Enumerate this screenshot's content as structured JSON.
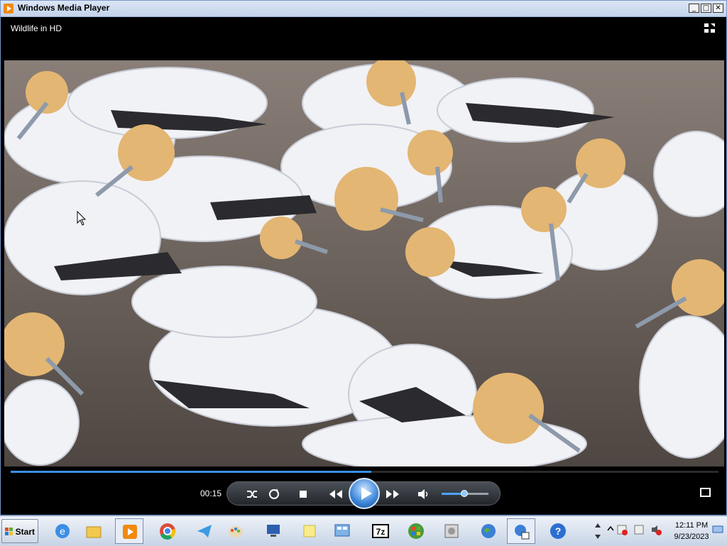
{
  "window": {
    "title": "Windows Media Player"
  },
  "media": {
    "title": "Wildlife in HD",
    "elapsed": "00:15",
    "progress": 0.51,
    "volume": 0.52
  },
  "taskbar": {
    "start_label": "Start",
    "icons": [
      "ie-icon",
      "folder-icon",
      "media-player-icon",
      "chrome-icon",
      "telegram-icon",
      "paint-icon",
      "remote-desktop-icon",
      "notes-icon",
      "control-panel-icon",
      "7zip-icon",
      "windows-flag-icon",
      "disk-icon",
      "network-globe-icon",
      "network-settings-icon",
      "help-icon"
    ],
    "clock_time": "12:11 PM",
    "clock_date": "9/23/2023"
  },
  "icons": {
    "seven_zip_label": "7z",
    "help_label": "?"
  },
  "colors": {
    "accent": "#3b8fe3",
    "titlebar": "#c3d3ea"
  }
}
